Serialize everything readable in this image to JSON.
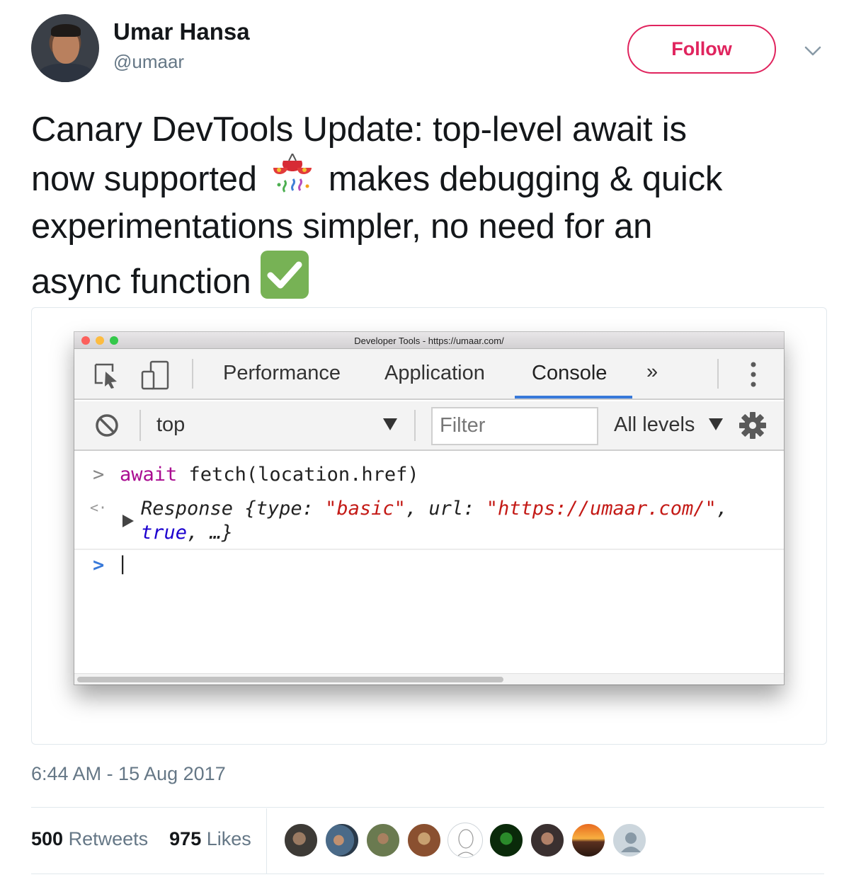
{
  "user": {
    "display_name": "Umar Hansa",
    "handle": "@umaar",
    "follow_label": "Follow"
  },
  "tweet": {
    "line1": "Canary DevTools Update: top-level await is",
    "line2_a": "now supported",
    "line2_b": "makes debugging & quick",
    "line3": "experimentations simpler, no need for an",
    "line4": "async function",
    "emojis": [
      "confetti-ball-icon",
      "check-mark-button-icon"
    ]
  },
  "devtools": {
    "window_title": "Developer Tools - https://umaar.com/",
    "tabs": [
      "Performance",
      "Application",
      "Console",
      "»"
    ],
    "active_tab": "Console",
    "context": "top",
    "filter_placeholder": "Filter",
    "levels": "All levels",
    "input_prompt": ">",
    "input_kw": "await",
    "input_rest": "fetch(location.href)",
    "output_prompt": "<·",
    "output_class": "Response",
    "output_open": "{type: ",
    "output_type": "\"basic\"",
    "output_mid": ", url: ",
    "output_url": "\"https://umaar.com/\"",
    "output_comma": ",",
    "output_bool": "true",
    "output_end": ", …}",
    "cursor_prompt": ">",
    "cursor": "|"
  },
  "meta": {
    "timestamp": "6:44 AM - 15 Aug 2017",
    "retweets_count": "500",
    "retweets_label": "Retweets",
    "likes_count": "975",
    "likes_label": "Likes"
  },
  "colors": {
    "follow": "#e0245e",
    "secondary_text": "#657786",
    "devtools_active_tab": "#3879d9",
    "console_keyword": "#aa0d91",
    "console_string": "#c41a16",
    "console_bool": "#1c00cf"
  }
}
